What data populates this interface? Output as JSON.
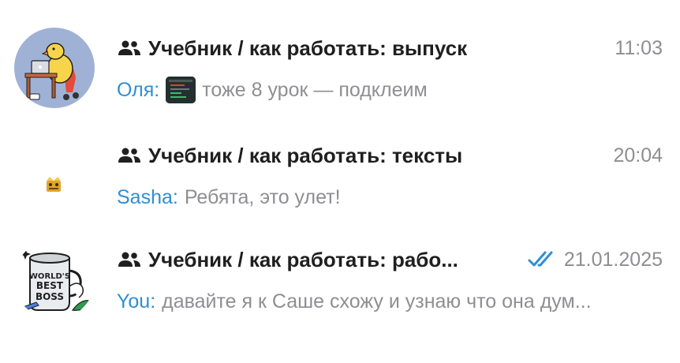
{
  "colors": {
    "sender": "#2f8ed6",
    "preview": "#8e8e93",
    "title": "#1f1f1f",
    "read_checks": "#2f8ed6"
  },
  "chats": [
    {
      "title": "Учебник / как работать: выпуск",
      "time": "11:03",
      "sender": "Оля",
      "separator": ":",
      "preview": "тоже 8 урок — подклеим",
      "has_media_thumbnail": true,
      "avatar_icon": "duck-at-laptop-icon",
      "read_status": "none"
    },
    {
      "title": "Учебник / как работать: тексты",
      "time": "20:04",
      "sender": "Sasha",
      "separator": ":",
      "preview": "Ребята, это улет!",
      "has_media_thumbnail": false,
      "avatar_icon": "small-emoji-icon",
      "read_status": "none"
    },
    {
      "title": "Учебник / как работать: рабо...",
      "time": "21.01.2025",
      "sender": "You",
      "separator": ":",
      "preview": "давайте я к Саше схожу и узнаю что она дум...",
      "has_media_thumbnail": false,
      "avatar_icon": "worlds-best-boss-mug-icon",
      "avatar_text": "WORLD'S BEST BOSS",
      "read_status": "read-double-check"
    }
  ]
}
